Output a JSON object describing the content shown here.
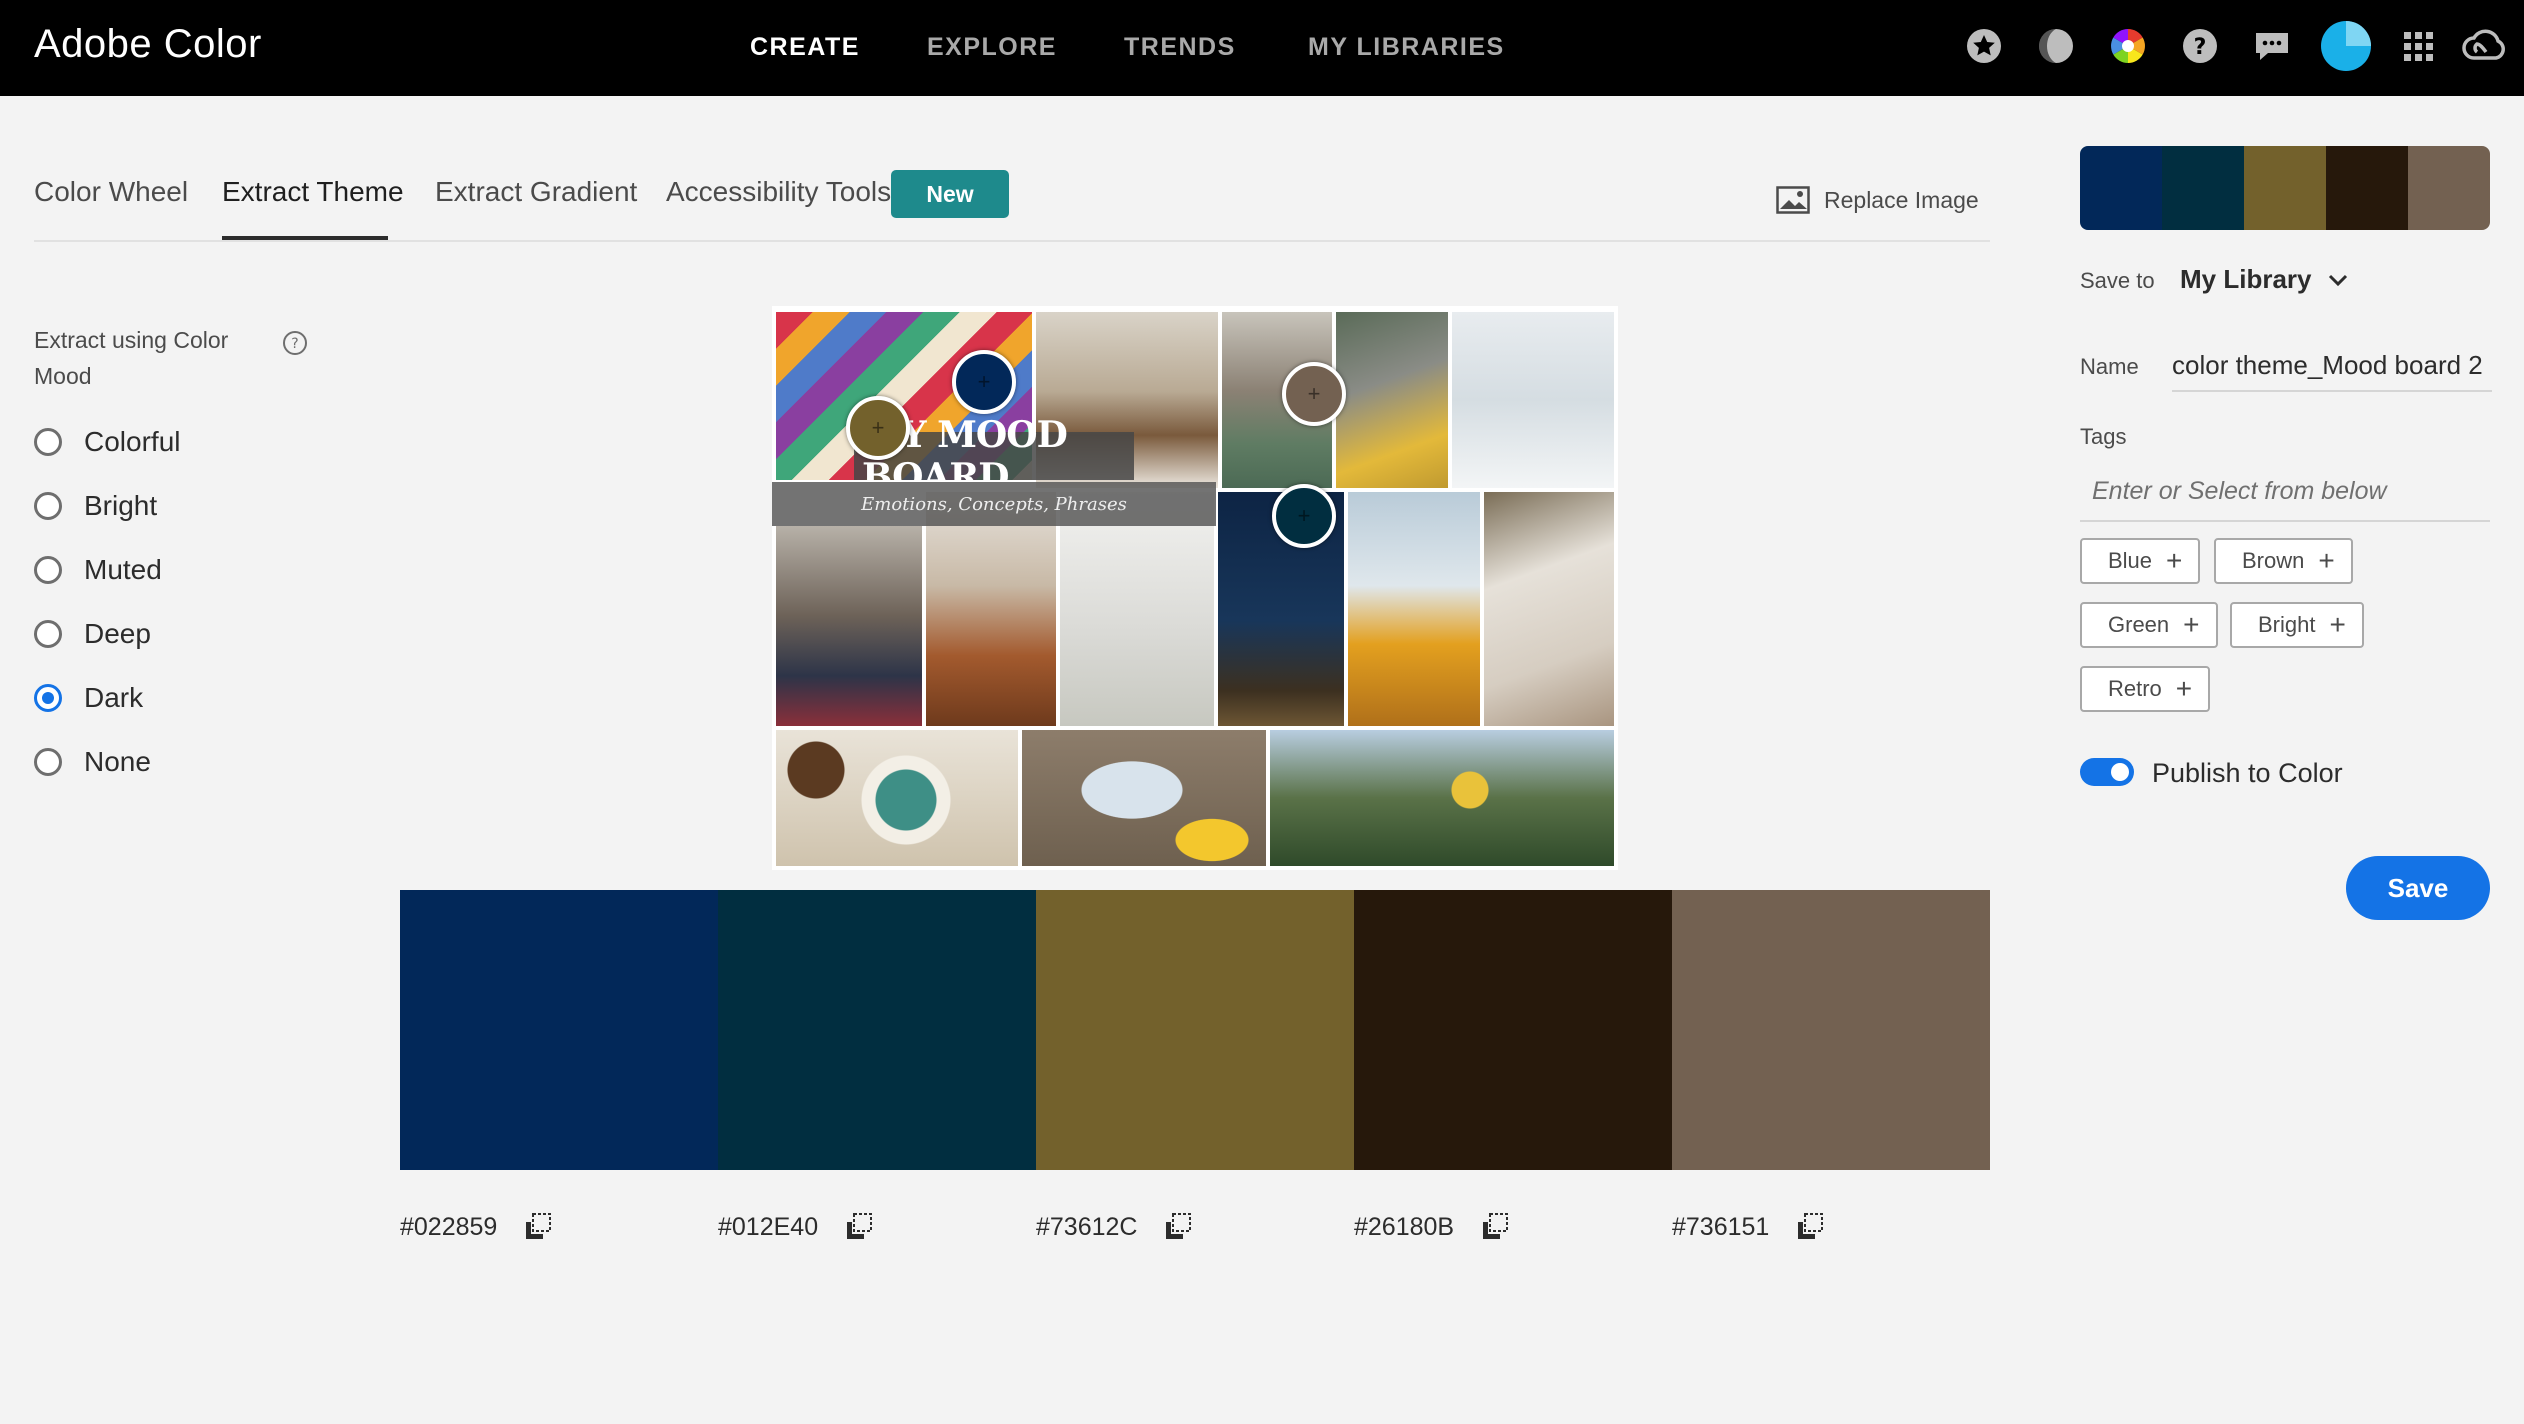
{
  "app": {
    "title": "Adobe Color"
  },
  "topnav": [
    {
      "label": "CREATE",
      "active": true
    },
    {
      "label": "EXPLORE",
      "active": false
    },
    {
      "label": "TRENDS",
      "active": false
    },
    {
      "label": "MY LIBRARIES",
      "active": false
    }
  ],
  "top_icons": [
    "star-icon",
    "contrast-icon",
    "color-wheel-icon",
    "help-icon",
    "chat-icon",
    "profile-avatar",
    "apps-grid-icon",
    "creative-cloud-icon"
  ],
  "tabs": [
    {
      "label": "Color Wheel",
      "active": false
    },
    {
      "label": "Extract Theme",
      "active": true
    },
    {
      "label": "Extract Gradient",
      "active": false
    },
    {
      "label": "Accessibility Tools",
      "active": false
    }
  ],
  "new_badge": "New",
  "replace_image_label": "Replace Image",
  "mood": {
    "label": "Extract using Color Mood",
    "options": [
      {
        "label": "Colorful",
        "checked": false
      },
      {
        "label": "Bright",
        "checked": false
      },
      {
        "label": "Muted",
        "checked": false
      },
      {
        "label": "Deep",
        "checked": false
      },
      {
        "label": "Dark",
        "checked": true
      },
      {
        "label": "None",
        "checked": false
      }
    ]
  },
  "board": {
    "title": "MY MOOD BOARD",
    "subtitle": "Emotions, Concepts, Phrases"
  },
  "swatches": [
    {
      "hex": "#022859",
      "color": "#022859"
    },
    {
      "hex": "#012E40",
      "color": "#012E40"
    },
    {
      "hex": "#73612C",
      "color": "#73612C"
    },
    {
      "hex": "#26180B",
      "color": "#26180B"
    },
    {
      "hex": "#736151",
      "color": "#736151"
    }
  ],
  "sidebar": {
    "save_to_label": "Save to",
    "library": "My Library",
    "name_label": "Name",
    "name_value": "color theme_Mood board 2",
    "tags_label": "Tags",
    "tags_placeholder": "Enter or Select from below",
    "tags": [
      "Blue",
      "Brown",
      "Green",
      "Bright",
      "Retro"
    ],
    "publish_label": "Publish to Color",
    "publish_on": true,
    "save_label": "Save"
  }
}
